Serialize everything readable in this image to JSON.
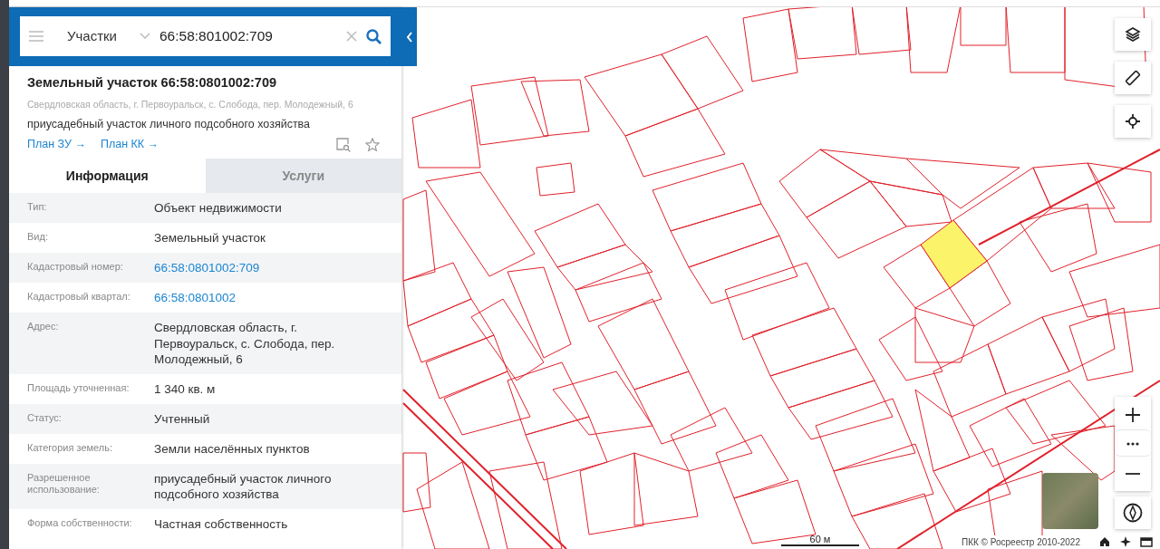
{
  "search": {
    "category": "Участки",
    "value": "66:58:801002:709"
  },
  "object": {
    "title": "Земельный участок 66:58:0801002:709",
    "address": "Свердловская область, г. Первоуральск, с. Слобода, пер. Молодежный, 6",
    "purpose": "приусадебный участок личного подсобного хозяйства",
    "links": [
      "План ЗУ →",
      "План КК →"
    ]
  },
  "tabs": [
    {
      "label": "Информация",
      "selected": true
    },
    {
      "label": "Услуги",
      "selected": false
    }
  ],
  "fields": [
    {
      "label": "Тип:",
      "value": "Объект недвижимости",
      "kind": "text"
    },
    {
      "label": "Вид:",
      "value": "Земельный участок",
      "kind": "text"
    },
    {
      "label": "Кадастровый номер:",
      "value": "66:58:0801002:709",
      "kind": "link"
    },
    {
      "label": "Кадастровый квартал:",
      "value": "66:58:0801002",
      "kind": "link"
    },
    {
      "label": "Адрес:",
      "value": "Свердловская область, г. Первоуральск, с. Слобода, пер. Молодежный, 6",
      "kind": "text"
    },
    {
      "label": "Площадь уточненная:",
      "value": "1 340 кв. м",
      "kind": "text"
    },
    {
      "label": "Статус:",
      "value": "Учтенный",
      "kind": "text"
    },
    {
      "label": "Категория земель:",
      "value": "Земли населённых пунктов",
      "kind": "text"
    },
    {
      "label": "Разрешенное использование:",
      "value": "приусадебный участок личного подсобного хозяйства",
      "kind": "text"
    },
    {
      "label": "Форма собственности:",
      "value": "Частная собственность",
      "kind": "text"
    }
  ],
  "map": {
    "scale": "60 м",
    "attribution": "ПКК © Росреестр 2010-2022"
  }
}
